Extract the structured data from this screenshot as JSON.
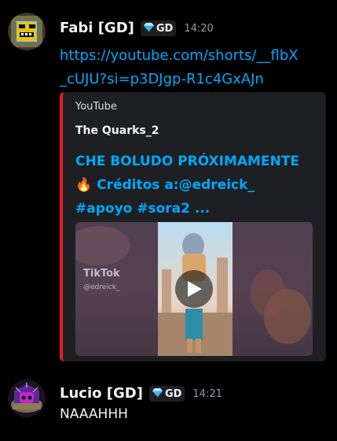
{
  "messages": [
    {
      "username": "Fabi [GD]",
      "tag": "GD",
      "timestamp": "14:20",
      "link_line_1": "https://youtube.com/shorts/__flbX",
      "link_line_2": "_cUJU?si=p3DJgp-R1c4GxAJn",
      "embed": {
        "provider": "YouTube",
        "author": "The Quarks_2",
        "title_line_1": "CHE BOLUDO PRÓXIMAMENTE",
        "title_line_2": "🔥 Créditos a:@edreick_",
        "title_line_3": "#apoyo #sora2 ...",
        "accent_color": "#ea1a26",
        "watermark": "TikTok",
        "watermark_user": "@edreick_"
      }
    },
    {
      "username": "Lucio [GD]",
      "tag": "GD",
      "timestamp": "14:21",
      "text": "NAAAHHH"
    }
  ],
  "icons": {
    "tag_icon": "diamond-icon",
    "play_icon": "play-icon"
  }
}
